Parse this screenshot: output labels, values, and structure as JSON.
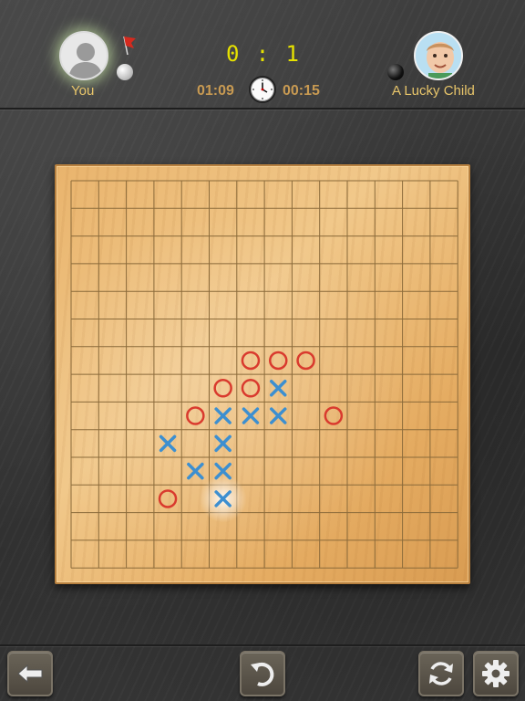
{
  "header": {
    "player_you": {
      "name": "You",
      "timer": "01:09",
      "stone": "white",
      "icon": "user-silhouette-icon"
    },
    "player_opponent": {
      "name": "A Lucky Child",
      "timer": "00:15",
      "stone": "black",
      "icon": "child-avatar"
    },
    "score": {
      "you": "0",
      "separator": ":",
      "opponent": "1"
    }
  },
  "board": {
    "size": 14,
    "colors": {
      "o": "#d93a2e",
      "x": "#3d8fd0",
      "grid": "#8a6a3a"
    },
    "pieces_o": [
      [
        6,
        6
      ],
      [
        7,
        6
      ],
      [
        8,
        6
      ],
      [
        5,
        7
      ],
      [
        6,
        7
      ],
      [
        4,
        8
      ],
      [
        9,
        8
      ],
      [
        3,
        11
      ]
    ],
    "pieces_x": [
      [
        7,
        7
      ],
      [
        5,
        8
      ],
      [
        6,
        8
      ],
      [
        7,
        8
      ],
      [
        3,
        9
      ],
      [
        5,
        9
      ],
      [
        4,
        10
      ],
      [
        5,
        10
      ],
      [
        5,
        11
      ]
    ]
  },
  "footer": {
    "buttons": [
      {
        "name": "back",
        "icon": "arrow-left-icon"
      },
      {
        "name": "undo",
        "icon": "undo-icon"
      },
      {
        "name": "restart",
        "icon": "refresh-icon"
      },
      {
        "name": "settings",
        "icon": "gear-icon"
      }
    ]
  }
}
